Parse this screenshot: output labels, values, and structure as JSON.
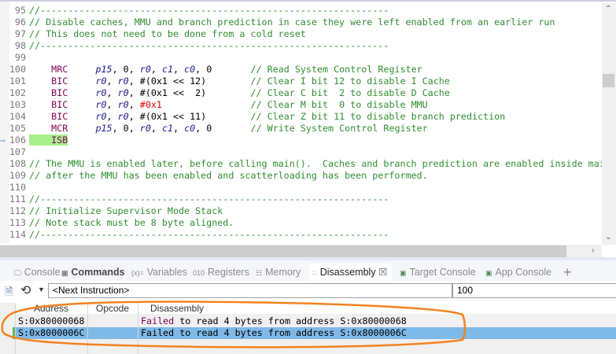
{
  "editor": {
    "current_line": "106",
    "lines": [
      {
        "n": "95",
        "segs": [
          [
            "c",
            "//---------------------------------------------------------------"
          ]
        ]
      },
      {
        "n": "96",
        "segs": [
          [
            "c",
            "// Disable caches, MMU and branch prediction in case they were left enabled from an earlier run"
          ]
        ]
      },
      {
        "n": "97",
        "segs": [
          [
            "c",
            "// This does not need to be done from a cold reset"
          ]
        ]
      },
      {
        "n": "98",
        "segs": [
          [
            "c",
            "//---------------------------------------------------------------"
          ]
        ]
      },
      {
        "n": "99",
        "segs": []
      },
      {
        "n": "100",
        "segs": [
          [
            "p",
            "    "
          ],
          [
            "k",
            "MRC"
          ],
          [
            "p",
            "     "
          ],
          [
            "o",
            "p15"
          ],
          [
            "p",
            ", 0, "
          ],
          [
            "o",
            "r0"
          ],
          [
            "p",
            ", "
          ],
          [
            "o",
            "c1"
          ],
          [
            "p",
            ", "
          ],
          [
            "o",
            "c0"
          ],
          [
            "p",
            ", 0       "
          ],
          [
            "c",
            "// Read System Control Register"
          ]
        ]
      },
      {
        "n": "101",
        "segs": [
          [
            "p",
            "    "
          ],
          [
            "k",
            "BIC"
          ],
          [
            "p",
            "     "
          ],
          [
            "o",
            "r0"
          ],
          [
            "p",
            ", "
          ],
          [
            "o",
            "r0"
          ],
          [
            "p",
            ", #(0x1 << 12)        "
          ],
          [
            "c",
            "// Clear I bit 12 to disable I Cache"
          ]
        ]
      },
      {
        "n": "102",
        "segs": [
          [
            "p",
            "    "
          ],
          [
            "k",
            "BIC"
          ],
          [
            "p",
            "     "
          ],
          [
            "o",
            "r0"
          ],
          [
            "p",
            ", "
          ],
          [
            "o",
            "r0"
          ],
          [
            "p",
            ", #(0x1 <<  2)        "
          ],
          [
            "c",
            "// Clear C bit  2 to disable D Cache"
          ]
        ]
      },
      {
        "n": "103",
        "segs": [
          [
            "p",
            "    "
          ],
          [
            "k",
            "BIC"
          ],
          [
            "p",
            "     "
          ],
          [
            "o",
            "r0"
          ],
          [
            "p",
            ", "
          ],
          [
            "o",
            "r0"
          ],
          [
            "p",
            ", "
          ],
          [
            "r",
            "#0x1"
          ],
          [
            "p",
            "                "
          ],
          [
            "c",
            "// Clear M bit  0 to disable MMU"
          ]
        ]
      },
      {
        "n": "104",
        "segs": [
          [
            "p",
            "    "
          ],
          [
            "k",
            "BIC"
          ],
          [
            "p",
            "     "
          ],
          [
            "o",
            "r0"
          ],
          [
            "p",
            ", "
          ],
          [
            "o",
            "r0"
          ],
          [
            "p",
            ", #(0x1 << 11)        "
          ],
          [
            "c",
            "// Clear Z bit 11 to disable branch prediction"
          ]
        ]
      },
      {
        "n": "105",
        "segs": [
          [
            "p",
            "    "
          ],
          [
            "k",
            "MCR"
          ],
          [
            "p",
            "     "
          ],
          [
            "o",
            "p15"
          ],
          [
            "p",
            ", 0, "
          ],
          [
            "o",
            "r0"
          ],
          [
            "p",
            ", "
          ],
          [
            "o",
            "c1"
          ],
          [
            "p",
            ", "
          ],
          [
            "o",
            "c0"
          ],
          [
            "p",
            ", 0       "
          ],
          [
            "c",
            "// Write System Control Register"
          ]
        ]
      },
      {
        "n": "106",
        "segs": [
          [
            "isb",
            "    "
          ],
          [
            "isb k",
            "ISB"
          ]
        ]
      },
      {
        "n": "107",
        "segs": []
      },
      {
        "n": "108",
        "segs": [
          [
            "c",
            "// The MMU is enabled later, before calling main().  Caches and branch prediction are enabled inside mai"
          ]
        ]
      },
      {
        "n": "109",
        "segs": [
          [
            "c",
            "// after the MMU has been enabled and scatterloading has been performed."
          ]
        ]
      },
      {
        "n": "110",
        "segs": []
      },
      {
        "n": "111",
        "segs": [
          [
            "c",
            "//---------------------------------------------------------------"
          ]
        ]
      },
      {
        "n": "112",
        "segs": [
          [
            "c",
            "// Initialize Supervisor Mode Stack"
          ]
        ]
      },
      {
        "n": "113",
        "segs": [
          [
            "c",
            "// Note stack must be 8 byte aligned."
          ]
        ]
      },
      {
        "n": "114",
        "segs": [
          [
            "c",
            "//---------------------------------------------------------------"
          ]
        ]
      }
    ]
  },
  "tabs": [
    {
      "label": "Console",
      "icon": "console-icon"
    },
    {
      "label": "Commands",
      "icon": "commands-icon"
    },
    {
      "label": "Variables",
      "icon": "variables-icon"
    },
    {
      "label": "Registers",
      "icon": "registers-icon"
    },
    {
      "label": "Memory",
      "icon": "memory-icon"
    },
    {
      "label": "Disassembly",
      "icon": "disassembly-icon",
      "active": true
    },
    {
      "label": "Target Console",
      "icon": "target-console-icon"
    },
    {
      "label": "App Console",
      "icon": "app-console-icon"
    }
  ],
  "toolbar": {
    "address_value": "<Next Instruction>",
    "size_value": "100"
  },
  "table": {
    "columns": [
      "Address",
      "Opcode",
      "Disassembly"
    ],
    "rows": [
      {
        "address": "S:0x80000068",
        "opcode": "",
        "failed": "Failed",
        "rest": " to read 4 bytes from address S:0x80000068"
      },
      {
        "address": "S:0x8000006C",
        "opcode": "",
        "failed": "Failed",
        "rest": " to read 4 bytes from address S:0x8000006C",
        "selected": true
      }
    ]
  },
  "colors": {
    "annotation": "#f5821f",
    "selection": "#7eb9e8",
    "current_line": "#a8f08c"
  }
}
